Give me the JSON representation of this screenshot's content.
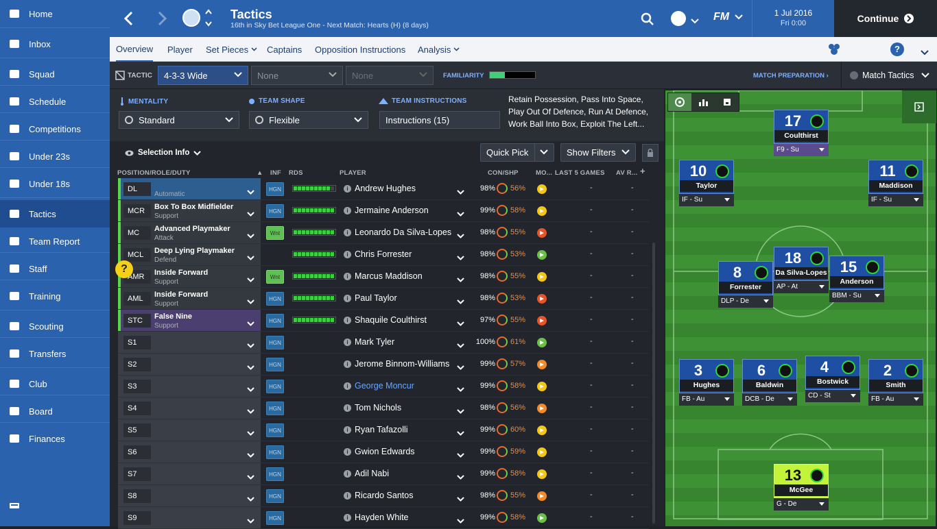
{
  "sidebar": {
    "items": [
      {
        "label": "Home",
        "icon": "home-icon"
      },
      {
        "label": "Inbox",
        "icon": "inbox-icon"
      },
      {
        "label": "Squad",
        "icon": "squad-icon"
      },
      {
        "label": "Schedule",
        "icon": "schedule-icon"
      },
      {
        "label": "Competitions",
        "icon": "trophy-icon"
      },
      {
        "label": "Under 23s",
        "icon": "u23-icon"
      },
      {
        "label": "Under 18s",
        "icon": "u18-icon"
      },
      {
        "label": "Tactics",
        "icon": "tactics-icon"
      },
      {
        "label": "Team Report",
        "icon": "report-icon"
      },
      {
        "label": "Staff",
        "icon": "staff-icon"
      },
      {
        "label": "Training",
        "icon": "training-icon"
      },
      {
        "label": "Scouting",
        "icon": "scouting-icon"
      },
      {
        "label": "Transfers",
        "icon": "transfers-icon"
      },
      {
        "label": "Club",
        "icon": "club-icon"
      },
      {
        "label": "Board",
        "icon": "board-icon"
      },
      {
        "label": "Finances",
        "icon": "finances-icon"
      }
    ],
    "active": "Tactics"
  },
  "header": {
    "title": "Tactics",
    "subtitle": "16th in Sky Bet League One - Next Match: Hearts (H) (8 days)",
    "date": "1 Jul 2016",
    "time": "Fri 0:00",
    "continue_label": "Continue",
    "fm_label": "FM"
  },
  "subnav": {
    "tabs": [
      "Overview",
      "Player",
      "Set Pieces",
      "Captains",
      "Opposition Instructions",
      "Analysis"
    ],
    "active": "Overview"
  },
  "tacticbar": {
    "tactic_label": "TACTIC",
    "tactic_value": "4-3-3 Wide",
    "slot2": "None",
    "slot3": "None",
    "familiarity_label": "FAMILIARITY",
    "match_prep_label": "MATCH PREPARATION",
    "match_tactics_label": "Match Tactics"
  },
  "instructions": {
    "mentality_label": "MENTALITY",
    "mentality_value": "Standard",
    "shape_label": "TEAM SHAPE",
    "shape_value": "Flexible",
    "instructions_label": "TEAM INSTRUCTIONS",
    "instructions_value": "Instructions (15)",
    "summary_line1": "Retain Possession, Pass Into Space,",
    "summary_line2": "Play Out Of Defence, Run At Defence,",
    "summary_line3": "Work Ball Into Box, Exploit The Left..."
  },
  "table": {
    "selection_info": "Selection Info",
    "quick_pick": "Quick Pick",
    "show_filters": "Show Filters",
    "headers": {
      "position": "POSITION/ROLE/DUTY",
      "inf": "INF",
      "rds": "RDS",
      "player": "PLAYER",
      "con": "CON/SHP",
      "mo": "MO...",
      "last5": "LAST 5 GAMES",
      "avr": "AV R..."
    },
    "rows": [
      {
        "pos": "DL",
        "role": "",
        "duty": "Automatic",
        "inf": "HGN",
        "rds": 9,
        "player": "Andrew Hughes",
        "con": "98%",
        "shp": "56%",
        "mo": "#f5c518",
        "last5": "-",
        "avr": "-",
        "starter": true
      },
      {
        "pos": "MCR",
        "role": "Box To Box Midfielder",
        "duty": "Support",
        "inf": "HGN",
        "rds": 10,
        "player": "Jermaine Anderson",
        "con": "99%",
        "shp": "58%",
        "mo": "#f5c518",
        "last5": "-",
        "avr": "-",
        "starter": true
      },
      {
        "pos": "MC",
        "role": "Advanced Playmaker",
        "duty": "Attack",
        "inf": "Wnt",
        "rds": 10,
        "player": "Leonardo Da Silva-Lopes",
        "con": "98%",
        "shp": "55%",
        "mo": "#e5542a",
        "last5": "-",
        "avr": "-",
        "starter": true
      },
      {
        "pos": "MCL",
        "role": "Deep Lying Playmaker",
        "duty": "Defend",
        "inf": "",
        "rds": 10,
        "player": "Chris Forrester",
        "con": "98%",
        "shp": "53%",
        "mo": "#6cc04a",
        "last5": "-",
        "avr": "-",
        "starter": true
      },
      {
        "pos": "AMR",
        "role": "Inside Forward",
        "duty": "Support",
        "inf": "Wnt",
        "rds": 10,
        "player": "Marcus Maddison",
        "con": "98%",
        "shp": "55%",
        "mo": "#f5c518",
        "last5": "-",
        "avr": "-",
        "starter": true
      },
      {
        "pos": "AML",
        "role": "Inside Forward",
        "duty": "Support",
        "inf": "HGN",
        "rds": 10,
        "player": "Paul Taylor",
        "con": "98%",
        "shp": "53%",
        "mo": "#e5542a",
        "last5": "-",
        "avr": "-",
        "starter": true
      },
      {
        "pos": "STC",
        "role": "False Nine",
        "duty": "Support",
        "inf": "HGN",
        "rds": 10,
        "player": "Shaquile Coulthirst",
        "con": "97%",
        "shp": "55%",
        "mo": "#e5542a",
        "last5": "-",
        "avr": "-",
        "starter": true
      },
      {
        "pos": "S1",
        "role": "",
        "duty": "",
        "inf": "HGN",
        "rds": 0,
        "player": "Mark Tyler",
        "con": "100%",
        "shp": "61%",
        "mo": "#6cc04a",
        "last5": "-",
        "avr": "-",
        "starter": false
      },
      {
        "pos": "S2",
        "role": "",
        "duty": "",
        "inf": "HGN",
        "rds": 0,
        "player": "Jerome Binnom-Williams",
        "con": "99%",
        "shp": "57%",
        "mo": "#f08c2c",
        "last5": "-",
        "avr": "-",
        "starter": false
      },
      {
        "pos": "S3",
        "role": "",
        "duty": "",
        "inf": "HGN",
        "rds": 0,
        "player": "George Moncur",
        "con": "99%",
        "shp": "58%",
        "mo": "#f5c518",
        "last5": "-",
        "avr": "-",
        "starter": false,
        "link": true
      },
      {
        "pos": "S4",
        "role": "",
        "duty": "",
        "inf": "HGN",
        "rds": 0,
        "player": "Tom Nichols",
        "con": "98%",
        "shp": "56%",
        "mo": "#f08c2c",
        "last5": "-",
        "avr": "-",
        "starter": false
      },
      {
        "pos": "S5",
        "role": "",
        "duty": "",
        "inf": "HGN",
        "rds": 0,
        "player": "Ryan Tafazolli",
        "con": "99%",
        "shp": "60%",
        "mo": "#f5c518",
        "last5": "-",
        "avr": "-",
        "starter": false
      },
      {
        "pos": "S6",
        "role": "",
        "duty": "",
        "inf": "HGN",
        "rds": 0,
        "player": "Gwion Edwards",
        "con": "99%",
        "shp": "59%",
        "mo": "#f5c518",
        "last5": "-",
        "avr": "-",
        "starter": false
      },
      {
        "pos": "S7",
        "role": "",
        "duty": "",
        "inf": "HGN",
        "rds": 0,
        "player": "Adil Nabi",
        "con": "99%",
        "shp": "58%",
        "mo": "#f5c518",
        "last5": "-",
        "avr": "-",
        "starter": false
      },
      {
        "pos": "S8",
        "role": "",
        "duty": "",
        "inf": "HGN",
        "rds": 0,
        "player": "Ricardo Santos",
        "con": "98%",
        "shp": "55%",
        "mo": "#f08c2c",
        "last5": "-",
        "avr": "-",
        "starter": false
      },
      {
        "pos": "S9",
        "role": "",
        "duty": "",
        "inf": "HGN",
        "rds": 0,
        "player": "Hayden White",
        "con": "99%",
        "shp": "58%",
        "mo": "#6cc04a",
        "last5": "-",
        "avr": "-",
        "starter": false
      }
    ]
  },
  "pitch": {
    "players": [
      {
        "num": "17",
        "name": "Coulthirst",
        "role": "F9 - Su",
        "cap": true
      },
      {
        "num": "10",
        "name": "Taylor",
        "role": "IF - Su"
      },
      {
        "num": "11",
        "name": "Maddison",
        "role": "IF - Su"
      },
      {
        "num": "8",
        "name": "Forrester",
        "role": "DLP - De"
      },
      {
        "num": "18",
        "name": "Da Silva-Lopes",
        "role": "AP - At"
      },
      {
        "num": "15",
        "name": "Anderson",
        "role": "BBM - Su"
      },
      {
        "num": "3",
        "name": "Hughes",
        "role": "FB - Au"
      },
      {
        "num": "6",
        "name": "Baldwin",
        "role": "DCB - De"
      },
      {
        "num": "4",
        "name": "Bostwick",
        "role": "CD - St"
      },
      {
        "num": "2",
        "name": "Smith",
        "role": "FB - Au"
      },
      {
        "num": "13",
        "name": "McGee",
        "role": "G - De",
        "gk": true
      }
    ]
  },
  "colors": {
    "accent": "#2b62ad",
    "sidebar_active": "#1f4d8f",
    "rds_green": "#35d23a",
    "pitch": "#3c8c34"
  }
}
